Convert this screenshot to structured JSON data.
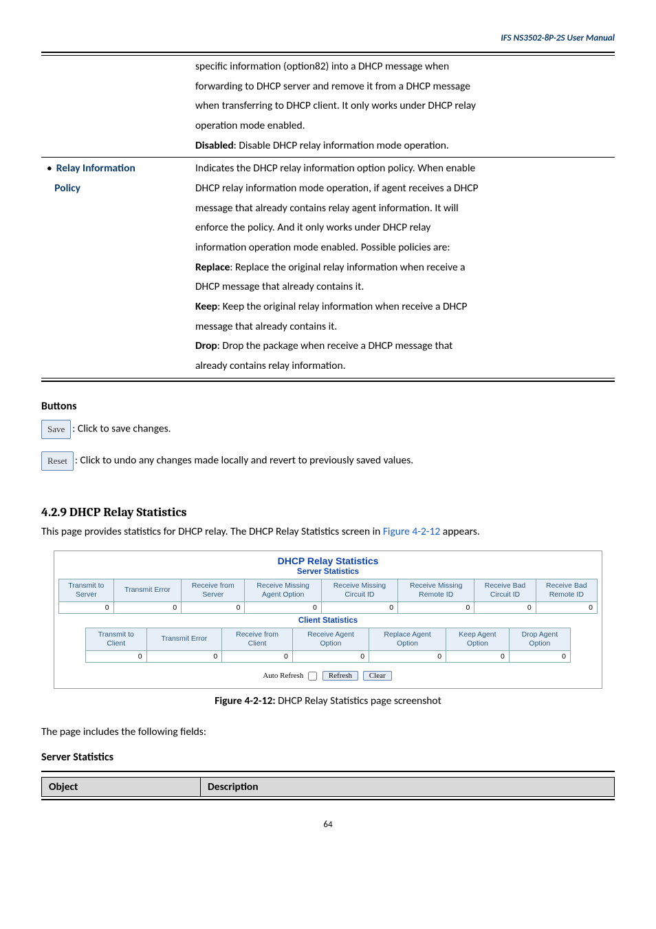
{
  "header": {
    "doc_title": "IFS  NS3502-8P-2S  User  Manual"
  },
  "param_table": {
    "row1_desc": [
      "specific information (option82) into a DHCP message when",
      "forwarding to DHCP server and remove it from a DHCP message",
      "when transferring to DHCP client. It only works under DHCP relay",
      "operation mode enabled.",
      {
        "b": "Disabled",
        "rest": ": Disable DHCP relay information mode operation."
      }
    ],
    "row2_label_l1": "Relay Information",
    "row2_label_l2": "Policy",
    "row2_desc": [
      "Indicates the DHCP relay information option policy. When enable",
      "DHCP relay information mode operation, if agent receives a DHCP",
      "message that already contains relay agent information. It will",
      "enforce the policy. And it only works under DHCP relay",
      "information operation mode enabled. Possible policies are:",
      {
        "b": "Replace",
        "rest": ": Replace the original relay information when receive a"
      },
      "DHCP message that already contains it.",
      {
        "b": "Keep",
        "rest": ": Keep the original relay information when receive a DHCP"
      },
      "message that already contains it.",
      {
        "b": "Drop",
        "rest": ": Drop the package when receive a DHCP message that"
      },
      "already contains relay information."
    ]
  },
  "buttons": {
    "heading": "Buttons",
    "save_label": "Save",
    "save_text": ": Click to save changes.",
    "reset_label": "Reset",
    "reset_text": ": Click to undo any changes made locally and revert to previously saved values."
  },
  "section": {
    "heading": "4.2.9 DHCP Relay Statistics",
    "intro_pre": "This page provides statistics for DHCP relay. The DHCP Relay Statistics screen in ",
    "intro_link": "Figure 4-2-12",
    "intro_post": " appears."
  },
  "stats": {
    "title": "DHCP Relay Statistics",
    "server_sub": "Server Statistics",
    "server_headers": [
      "Transmit to Server",
      "Transmit Error",
      "Receive from Server",
      "Receive Missing Agent Option",
      "Receive Missing Circuit ID",
      "Receive Missing Remote ID",
      "Receive Bad Circuit ID",
      "Receive Bad Remote ID"
    ],
    "server_vals": [
      "0",
      "0",
      "0",
      "0",
      "0",
      "0",
      "0",
      "0"
    ],
    "client_sub": "Client Statistics",
    "client_headers": [
      "Transmit to Client",
      "Transmit Error",
      "Receive from Client",
      "Receive Agent Option",
      "Replace Agent Option",
      "Keep Agent Option",
      "Drop Agent Option"
    ],
    "client_vals": [
      "0",
      "0",
      "0",
      "0",
      "0",
      "0",
      "0"
    ],
    "auto_refresh_label": "Auto Refresh",
    "refresh_btn": "Refresh",
    "clear_btn": "Clear"
  },
  "figcap": {
    "b": "Figure 4-2-12:",
    "rest": " DHCP Relay Statistics page screenshot"
  },
  "fields": {
    "intro": "The page includes the following fields:",
    "sub": "Server Statistics",
    "h1": "Object",
    "h2": "Description"
  },
  "footer": {
    "page": "64"
  }
}
